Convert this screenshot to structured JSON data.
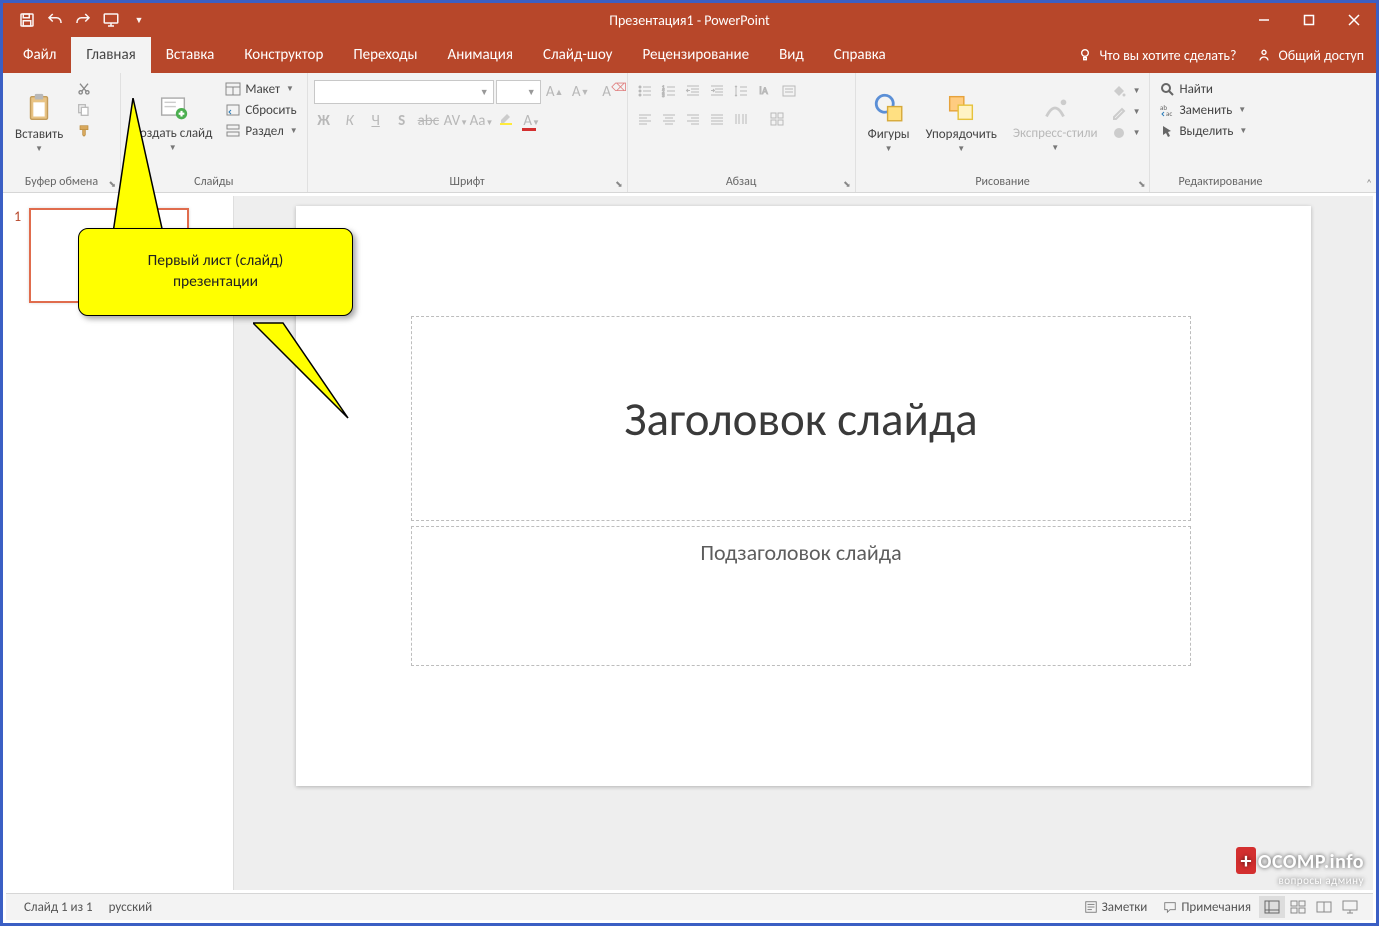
{
  "app": {
    "title": "Презентация1 - PowerPoint"
  },
  "tabs": {
    "file": "Файл",
    "home": "Главная",
    "insert": "Вставка",
    "design": "Конструктор",
    "transitions": "Переходы",
    "animations": "Анимация",
    "slideshow": "Слайд-шоу",
    "review": "Рецензирование",
    "view": "Вид",
    "help": "Справка",
    "tellme": "Что вы хотите сделать?",
    "share": "Общий доступ"
  },
  "ribbon": {
    "clipboard": {
      "label": "Буфер обмена",
      "paste": "Вставить"
    },
    "slides": {
      "label": "Слайды",
      "newslide": "Создать слайд",
      "layout": "Макет",
      "reset": "Сбросить",
      "section": "Раздел"
    },
    "font": {
      "label": "Шрифт"
    },
    "paragraph": {
      "label": "Абзац"
    },
    "drawing": {
      "label": "Рисование",
      "shapes": "Фигуры",
      "arrange": "Упорядочить",
      "quickstyles": "Экспресс-стили"
    },
    "editing": {
      "label": "Редактирование",
      "find": "Найти",
      "replace": "Заменить",
      "select": "Выделить"
    }
  },
  "thumbpanel": {
    "slide1_num": "1"
  },
  "callout": {
    "line1": "Первый лист (слайд)",
    "line2": "презентации"
  },
  "slide": {
    "title_placeholder": "Заголовок слайда",
    "subtitle_placeholder": "Подзаголовок слайда"
  },
  "status": {
    "slidecount": "Слайд 1 из 1",
    "language": "русский",
    "notes": "Заметки",
    "comments": "Примечания"
  },
  "watermark": {
    "brand": "OCOMP.info",
    "sub": "вопросы админу"
  }
}
